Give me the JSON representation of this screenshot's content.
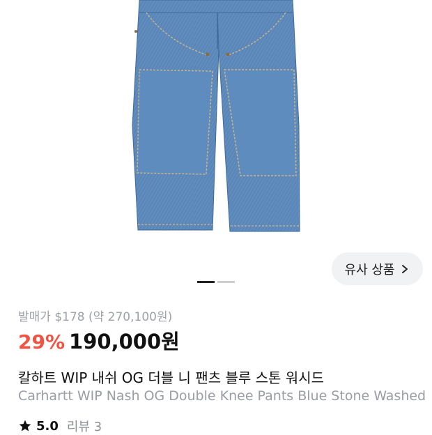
{
  "similar_button": {
    "label": "유사 상품",
    "icon": "chevron-right-icon"
  },
  "gallery": {
    "total_images": 2,
    "active_index": 1
  },
  "pricing": {
    "retail_label": "발매가 $178 (약 270,100원)",
    "discount": "29%",
    "price": "190,000원",
    "discount_color": "#ef5445"
  },
  "product": {
    "title_ko": "칼하트 WIP 내쉬 OG 더블 니 팬츠 블루 스톤 워시드",
    "title_en": "Carhartt WIP Nash OG Double Knee Pants Blue Stone Washed"
  },
  "rating": {
    "icon": "star-icon",
    "score": "5.0",
    "reviews_label": "리뷰 3"
  }
}
